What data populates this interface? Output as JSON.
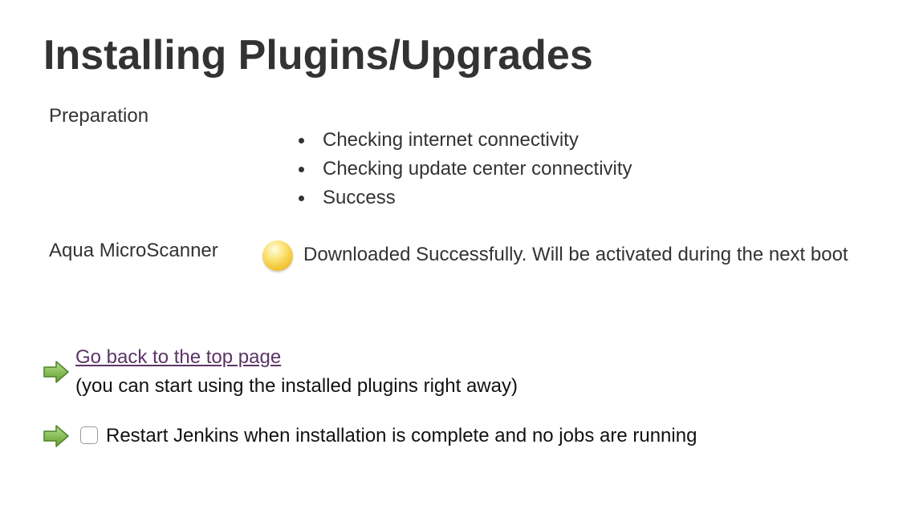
{
  "page": {
    "title": "Installing Plugins/Upgrades"
  },
  "preparation": {
    "label": "Preparation",
    "steps": [
      "Checking internet connectivity",
      "Checking update center connectivity",
      "Success"
    ]
  },
  "plugins": [
    {
      "name": "Aqua MicroScanner",
      "status_icon": "yellow-status-ball-icon",
      "status_color": "#f2c431",
      "status_text": "Downloaded Successfully. Will be activated during the next boot"
    }
  ],
  "actions": {
    "arrow_icon": "green-right-arrow-icon",
    "arrow_color": "#6aa53b",
    "back_link_text": "Go back to the top page",
    "back_link_color": "#5c3566",
    "back_note": "(you can start using the installed plugins right away)",
    "restart_checked": false,
    "restart_label": "Restart Jenkins when installation is complete and no jobs are running"
  }
}
